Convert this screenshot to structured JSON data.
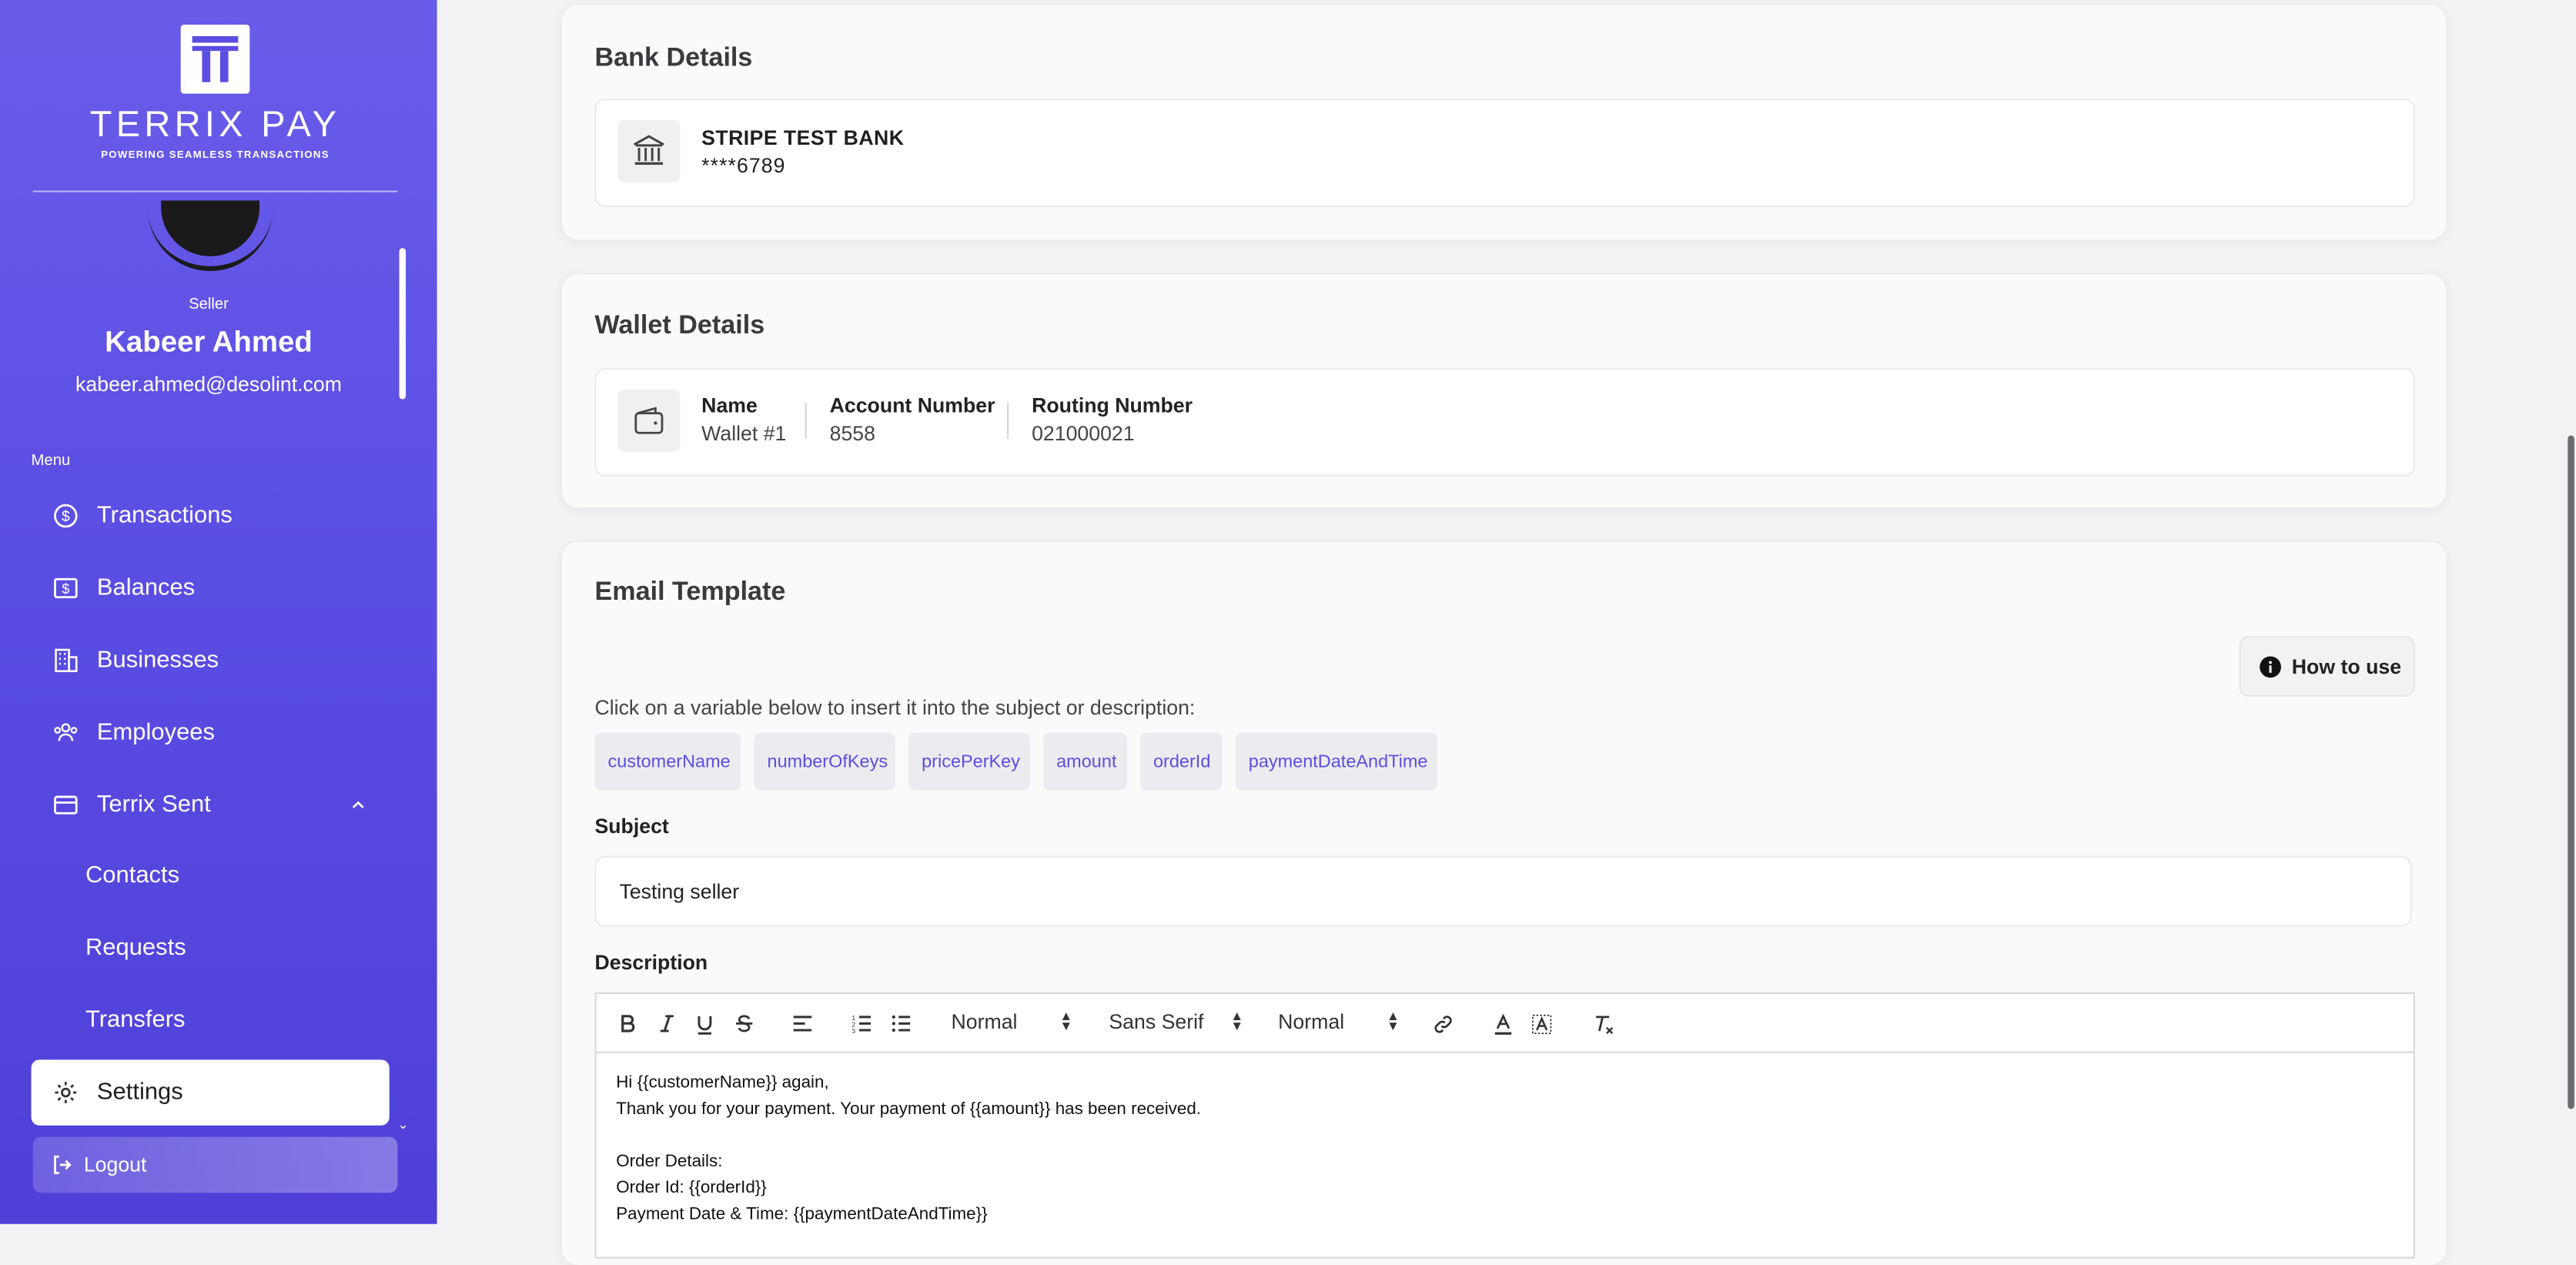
{
  "brand": {
    "name": "TERRIX PAY",
    "tagline": "POWERING SEAMLESS TRANSACTIONS"
  },
  "user": {
    "role": "Seller",
    "name": "Kabeer Ahmed",
    "email": "kabeer.ahmed@desolint.com"
  },
  "menu": {
    "header": "Menu",
    "items": [
      {
        "label": "Transactions",
        "icon": "dollar-circle-icon"
      },
      {
        "label": "Balances",
        "icon": "dollar-box-icon"
      },
      {
        "label": "Businesses",
        "icon": "building-icon"
      },
      {
        "label": "Employees",
        "icon": "people-icon"
      },
      {
        "label": "Terrix Sent",
        "icon": "card-icon",
        "expanded": true
      }
    ],
    "subitems": [
      {
        "label": "Contacts"
      },
      {
        "label": "Requests"
      },
      {
        "label": "Transfers"
      }
    ],
    "active": {
      "label": "Settings",
      "icon": "gear-icon"
    },
    "logout": {
      "label": "Logout",
      "icon": "logout-icon"
    }
  },
  "bank": {
    "title": "Bank Details",
    "name": "STRIPE TEST BANK",
    "masked": "****6789",
    "icon": "bank-icon"
  },
  "wallet": {
    "title": "Wallet Details",
    "icon": "wallet-icon",
    "fields": [
      {
        "label": "Name",
        "value": "Wallet #1"
      },
      {
        "label": "Account Number",
        "value": "8558"
      },
      {
        "label": "Routing Number",
        "value": "021000021"
      }
    ]
  },
  "email": {
    "title": "Email Template",
    "how_to_use": "How to use",
    "hint": "Click on a variable below to insert it into the subject or description:",
    "variables": [
      "customerName",
      "numberOfKeys",
      "pricePerKey",
      "amount",
      "orderId",
      "paymentDateAndTime"
    ],
    "subject_label": "Subject",
    "subject_value": "Testing seller",
    "description_label": "Description",
    "toolbar": {
      "header_select": "Normal",
      "font_select": "Sans Serif",
      "size_select": "Normal"
    },
    "body_lines": [
      "Hi {{customerName}} again,",
      "Thank you for your payment. Your payment of {{amount}} has been received.",
      "",
      "Order Details:",
      "Order Id: {{orderId}}",
      "Payment Date & Time: {{paymentDateAndTime}}"
    ]
  },
  "colors": {
    "sidebar_start": "#6a5ce9",
    "sidebar_end": "#4f3fd8",
    "accent": "#5b4ee3",
    "page_bg": "#f2f2f4"
  }
}
